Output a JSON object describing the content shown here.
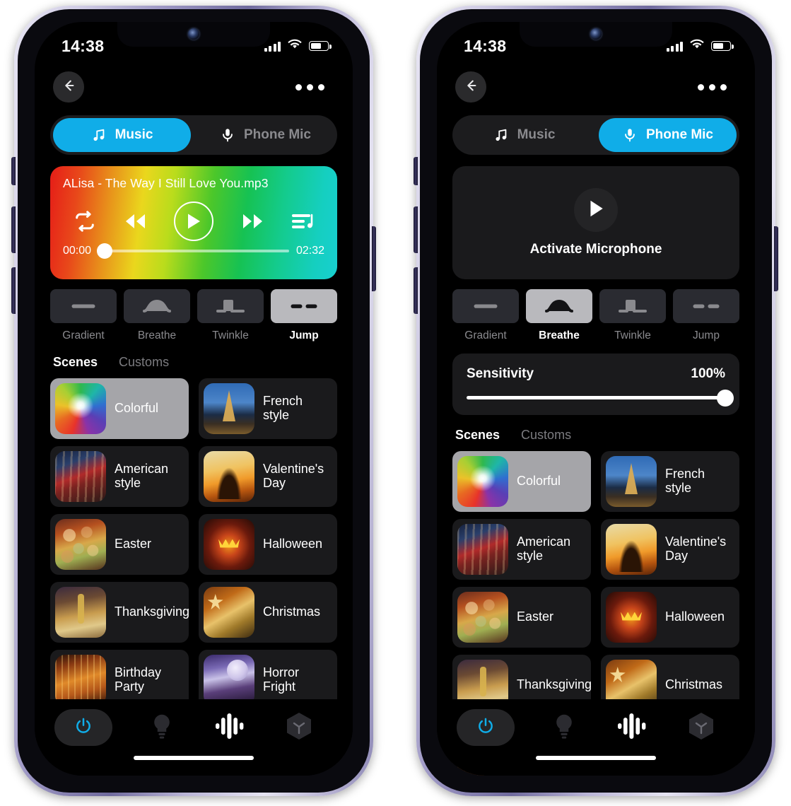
{
  "status": {
    "time": "14:38",
    "signal_icon": "signal-bars-icon",
    "wifi_icon": "wifi-icon",
    "battery_icon": "battery-icon"
  },
  "header": {
    "back_icon": "back-arrow-icon",
    "more_icon": "more-options-icon"
  },
  "source_tabs": [
    {
      "label": "Music",
      "icon": "music-note-icon"
    },
    {
      "label": "Phone Mic",
      "icon": "microphone-icon"
    }
  ],
  "player": {
    "track_title": "ALisa - The Way I Still Love You.mp3",
    "elapsed": "00:00",
    "duration": "02:32",
    "progress_percent": 0,
    "repeat_icon": "repeat-icon",
    "prev_icon": "rewind-icon",
    "play_icon": "play-icon",
    "next_icon": "fast-forward-icon",
    "playlist_icon": "playlist-icon"
  },
  "mic_card": {
    "label": "Activate Microphone",
    "play_icon": "play-icon"
  },
  "modes": [
    {
      "label": "Gradient",
      "icon": "gradient-line-icon"
    },
    {
      "label": "Breathe",
      "icon": "breathe-wave-icon"
    },
    {
      "label": "Twinkle",
      "icon": "twinkle-pulse-icon"
    },
    {
      "label": "Jump",
      "icon": "jump-dash-icon"
    }
  ],
  "left_phone": {
    "active_source": "Music",
    "active_mode": "Jump"
  },
  "right_phone": {
    "active_source": "Phone Mic",
    "active_mode": "Breathe"
  },
  "sensitivity": {
    "label": "Sensitivity",
    "value": "100%",
    "percent": 100
  },
  "scene_tabs": [
    {
      "label": "Scenes"
    },
    {
      "label": "Customs"
    }
  ],
  "active_scene_tab": "Scenes",
  "selected_scene": "Colorful",
  "scenes": [
    {
      "name": "Colorful",
      "art": "t-colorful"
    },
    {
      "name": "French style",
      "art": "t-french"
    },
    {
      "name": "American style",
      "art": "t-american"
    },
    {
      "name": "Valentine's Day",
      "art": "t-valentine"
    },
    {
      "name": "Easter",
      "art": "t-easter"
    },
    {
      "name": "Halloween",
      "art": "t-halloween"
    },
    {
      "name": "Thanksgiving",
      "art": "t-thanks"
    },
    {
      "name": "Christmas",
      "art": "t-christmas"
    },
    {
      "name": "Birthday Party",
      "art": "t-birthday"
    },
    {
      "name": "Horror Fright",
      "art": "t-horror"
    }
  ],
  "bottom_nav": [
    {
      "name": "power-button",
      "icon": "power-icon",
      "active": true
    },
    {
      "name": "light-tab",
      "icon": "bulb-icon",
      "active": false
    },
    {
      "name": "music-tab",
      "icon": "waveform-icon",
      "active": true
    },
    {
      "name": "scene-tab",
      "icon": "cube-icon",
      "active": false
    }
  ],
  "colors": {
    "accent": "#10ade8",
    "selected_row": "#a5a5a9",
    "card_bg": "#1a1a1c",
    "screen_bg": "#000000"
  }
}
